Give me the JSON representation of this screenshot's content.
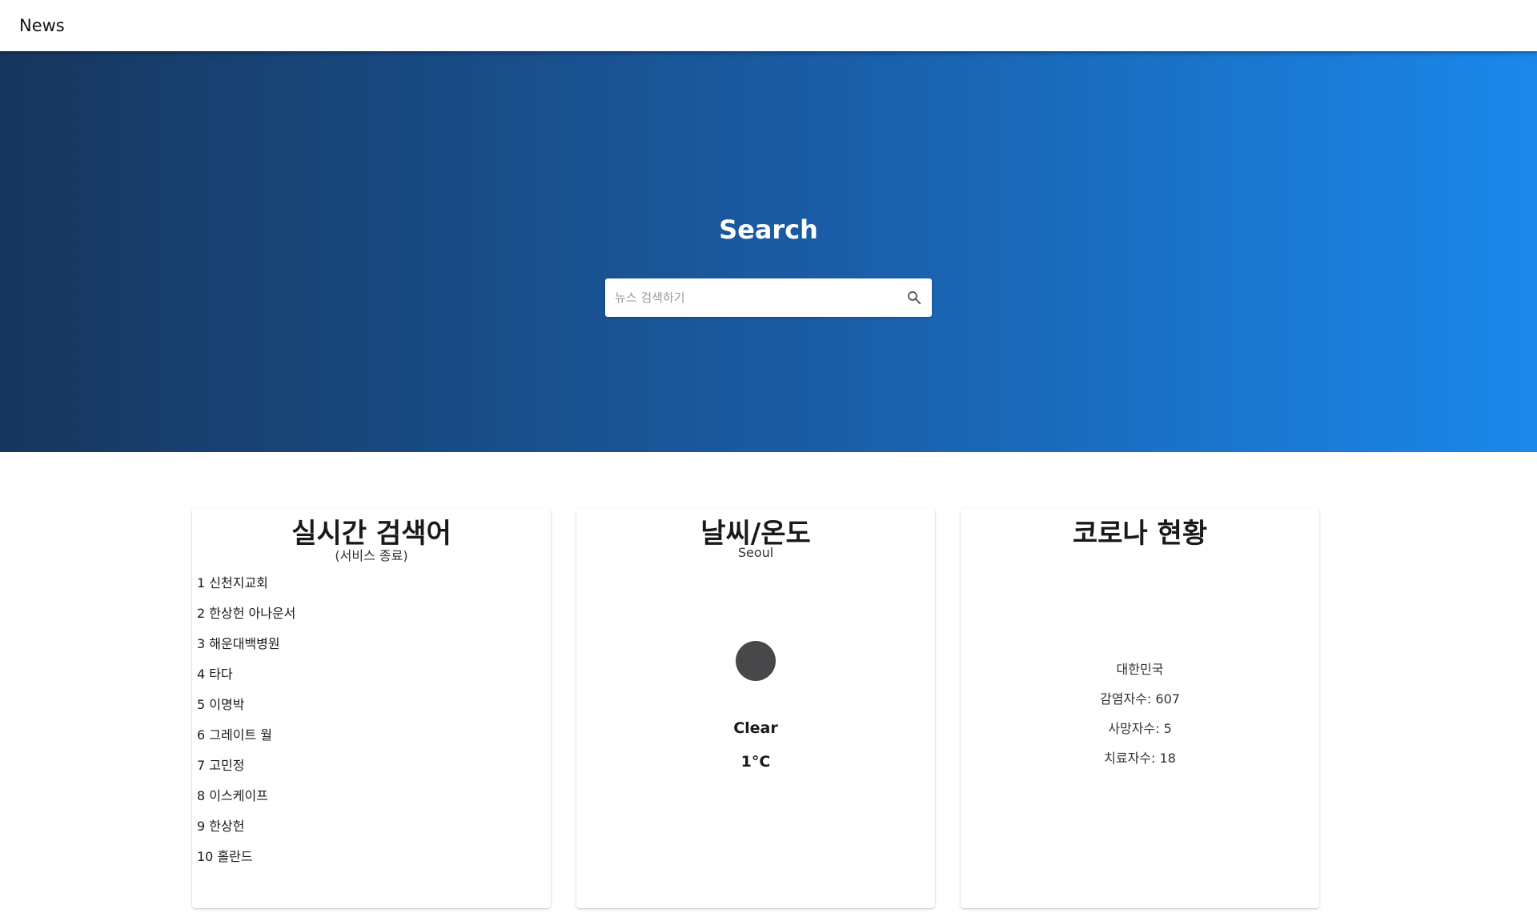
{
  "appbar": {
    "title": "News"
  },
  "hero": {
    "title": "Search",
    "search": {
      "placeholder": "뉴스 검색하기",
      "value": ""
    }
  },
  "trending": {
    "title": "실시간 검색어",
    "subtitle": "(서비스 종료)",
    "items": [
      {
        "rank": "1",
        "label": "신천지교회"
      },
      {
        "rank": "2",
        "label": "한상헌 아나운서"
      },
      {
        "rank": "3",
        "label": "해운대백병원"
      },
      {
        "rank": "4",
        "label": "타다"
      },
      {
        "rank": "5",
        "label": "이명박"
      },
      {
        "rank": "6",
        "label": "그레이트 월"
      },
      {
        "rank": "7",
        "label": "고민정"
      },
      {
        "rank": "8",
        "label": "이스케이프"
      },
      {
        "rank": "9",
        "label": "한상헌"
      },
      {
        "rank": "10",
        "label": "홀란드"
      }
    ]
  },
  "weather": {
    "title": "날씨/온도",
    "city": "Seoul",
    "condition": "Clear",
    "temperature": "1°C",
    "icon": "dark-circle-icon",
    "icon_color": "#48484a"
  },
  "covid": {
    "title": "코로나 현황",
    "country": "대한민국",
    "confirmed": "감염자수: 607",
    "deaths": "사망자수: 5",
    "recovered": "치료자수: 18"
  },
  "colors": {
    "hero_gradient_start": "#17365d",
    "hero_gradient_end": "#1a88eb"
  }
}
